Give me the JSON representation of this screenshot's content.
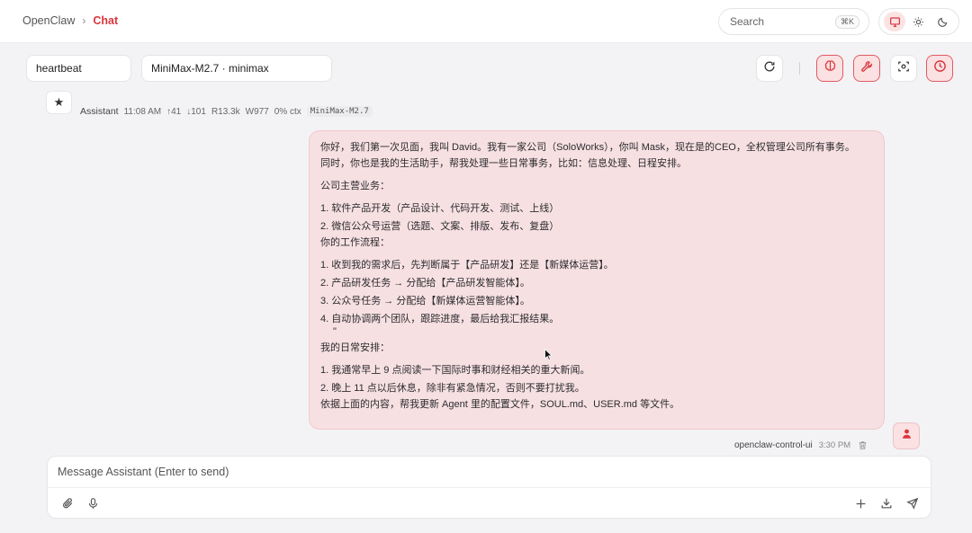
{
  "breadcrumb": {
    "root": "OpenClaw",
    "separator": "›",
    "current": "Chat"
  },
  "search": {
    "label": "Search",
    "shortcut": "⌘K"
  },
  "theme": {
    "options": [
      "system",
      "light",
      "dark"
    ],
    "active": "system"
  },
  "session": {
    "name": "heartbeat",
    "model": "MiniMax-M2.7 · minimax"
  },
  "toolbar": {
    "icons": [
      "refresh-icon",
      "brain-icon",
      "wrench-icon",
      "focus-icon",
      "clock-icon"
    ]
  },
  "assistant_meta": {
    "name": "Assistant",
    "time": "11:08 AM",
    "tokens_in": "↑41",
    "tokens_out": "↓101",
    "cache_read": "R13.3k",
    "cache_write": "W977",
    "ctx": "0% ctx",
    "model": "MiniMax-M2.7"
  },
  "message": {
    "intro_line1": "你好，我们第一次见面，我叫 David。我有一家公司（SoloWorks），你叫 Mask，现在是的CEO，全权管理公司所有事务。",
    "intro_line2": "同时，你也是我的生活助手，帮我处理一些日常事务，比如：信息处理、日程安排。",
    "business_title": "公司主营业务：",
    "business_items": [
      "1. 软件产品开发（产品设计、代码开发、测试、上线）",
      "2. 微信公众号运营（选题、文案、排版、发布、复盘）"
    ],
    "workflow_title": "你的工作流程：",
    "workflow_items": [
      "1. 收到我的需求后，先判断属于【产品研发】还是【新媒体运营】。",
      "2. 产品研发任务 → 分配给【产品研发智能体】。",
      "3. 公众号任务 → 分配给【新媒体运营智能体】。",
      "4. 自动协调两个团队，跟踪进度，最后给我汇报结果。"
    ],
    "quote_mark": "\"",
    "daily_title": "我的日常安排：",
    "daily_items": [
      "1. 我通常早上 9 点阅读一下国际时事和财经相关的重大新闻。",
      "2. 晚上 11 点以后休息，除非有紧急情况，否则不要打扰我。"
    ],
    "closing": "依据上面的内容，帮我更新 Agent 里的配置文件，SOUL.md、USER.md 等文件。"
  },
  "sender": {
    "name": "openclaw-control-ui",
    "time": "3:30 PM"
  },
  "composer": {
    "placeholder": "Message Assistant (Enter to send)",
    "value": ""
  },
  "colors": {
    "accent": "#d9363e",
    "bubble_bg": "#f7e0e2",
    "bubble_border": "#efc9cc"
  }
}
